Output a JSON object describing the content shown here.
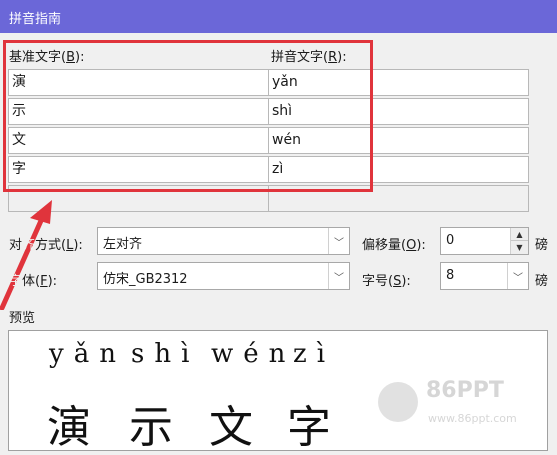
{
  "window": {
    "title": "拼音指南"
  },
  "columns": {
    "base_text_label": "基准文字(",
    "base_text_key": "B",
    "base_text_suffix": "):",
    "pinyin_text_label": "拼音文字(",
    "pinyin_text_key": "R",
    "pinyin_text_suffix": "):"
  },
  "rows": [
    {
      "base": "演",
      "pinyin": "yǎn"
    },
    {
      "base": "示",
      "pinyin": "shì"
    },
    {
      "base": "文",
      "pinyin": "wén"
    },
    {
      "base": "字",
      "pinyin": "zì"
    },
    {
      "base": "",
      "pinyin": ""
    },
    {
      "base": "",
      "pinyin": ""
    }
  ],
  "alignment": {
    "label_prefix": "对",
    "label_hidden": "齐",
    "label_suffix": "方式(",
    "key": "L",
    "label_end": "):",
    "value": "左对齐"
  },
  "offset": {
    "label": "偏移量(",
    "key": "O",
    "label_end": "):",
    "value": "0",
    "unit": "磅"
  },
  "font": {
    "label_hidden": "字",
    "label_suffix": "体(",
    "key": "F",
    "label_end": "):",
    "value": "仿宋_GB2312"
  },
  "size": {
    "label": "字号(",
    "key": "S",
    "label_end": "):",
    "value": "8",
    "unit": "磅"
  },
  "preview": {
    "label": "预览",
    "pinyin": [
      "yǎn",
      "shì",
      "wén",
      "zì"
    ],
    "hanzi": [
      "演",
      "示",
      "文",
      "字"
    ]
  },
  "watermark": {
    "brand": "86PPT",
    "url": "www.86ppt.com"
  },
  "colors": {
    "titlebar": "#6b67d8",
    "highlight": "#e0343c",
    "background": "#f0f0f0"
  }
}
